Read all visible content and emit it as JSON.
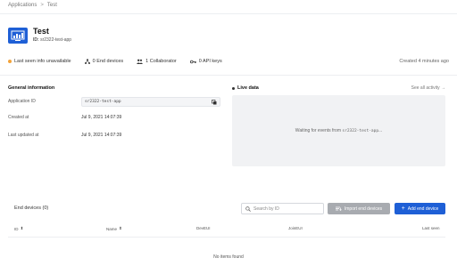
{
  "breadcrumb": {
    "root": "Applications",
    "current": "Test"
  },
  "app": {
    "title": "Test",
    "id_label": "ID:",
    "id_value": "sr2322-test-app"
  },
  "stats": {
    "last_seen": "Last seen info unavailable",
    "end_devices": "0 End devices",
    "collaborators": "1 Collaborator",
    "api_keys": "0 API keys",
    "created": "Created 4 minutes ago"
  },
  "general": {
    "title": "General information",
    "app_id_label": "Application ID",
    "app_id_value": "sr2322-test-app",
    "created_label": "Created at",
    "created_value": "Jul 9, 2021 14:07:39",
    "updated_label": "Last updated at",
    "updated_value": "Jul 9, 2021 14:07:39"
  },
  "live": {
    "title": "Live data",
    "see_all": "See all activity →",
    "waiting_prefix": "Waiting for events from",
    "waiting_id": "sr2322-test-app",
    "waiting_suffix": "..."
  },
  "end_devices": {
    "title": "End devices (0)",
    "search_placeholder": "Search by ID",
    "import_label": "Import end devices",
    "add_label": "Add end device",
    "columns": [
      "ID",
      "Name",
      "DevEUI",
      "JoinEUI",
      "Last seen"
    ],
    "empty": "No items found"
  },
  "colors": {
    "accent": "#1e5fd6",
    "status_dot": "#f3a33a",
    "disabled": "#a8abb0"
  }
}
